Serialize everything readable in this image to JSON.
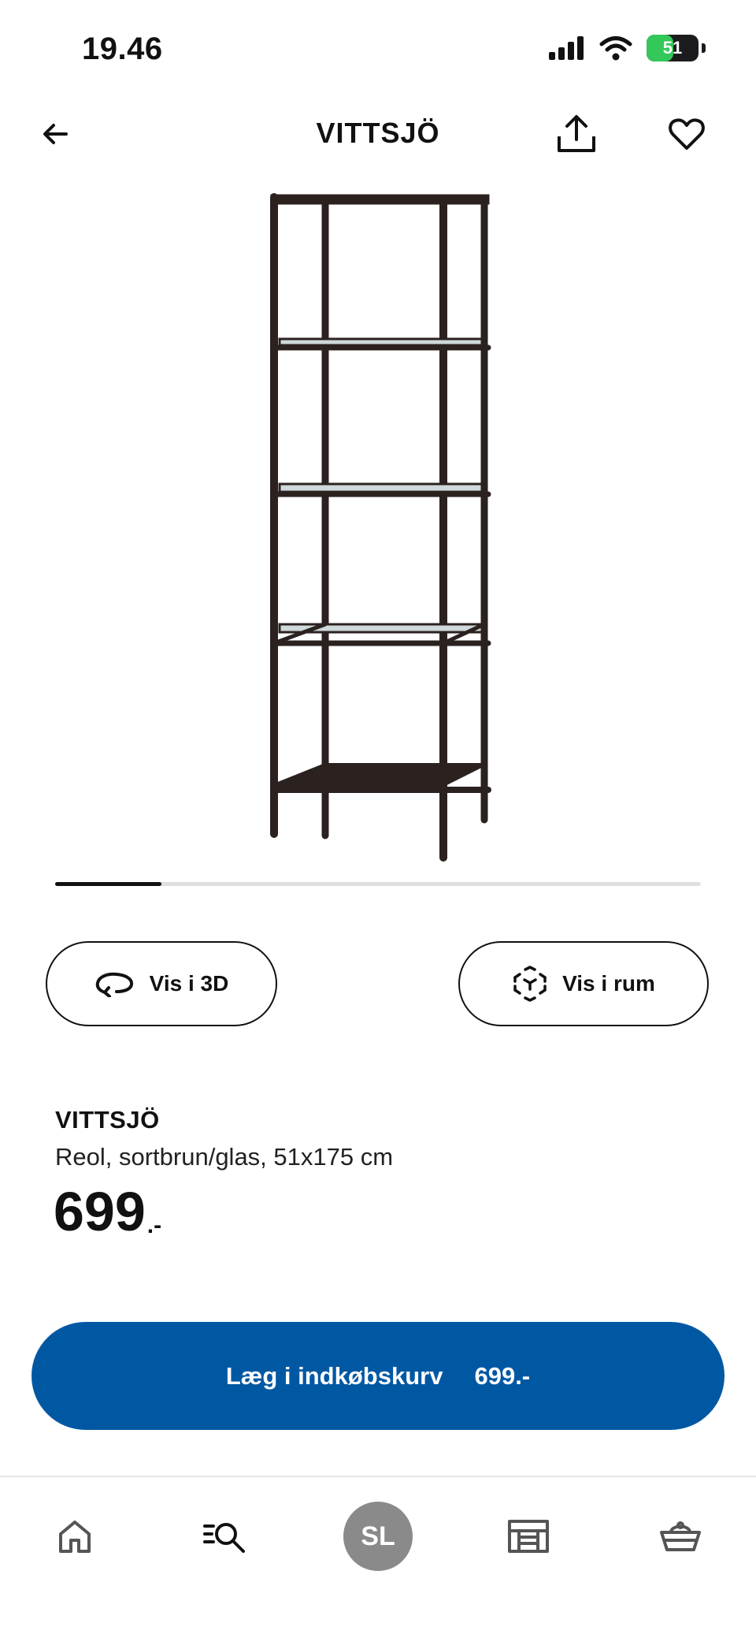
{
  "status_bar": {
    "time": "19.46",
    "battery_level": "51",
    "battery_fraction": 0.51,
    "icons": [
      "signal-icon",
      "wifi-icon",
      "battery-icon"
    ]
  },
  "nav": {
    "title": "VITTSJÖ",
    "icons": [
      "back-arrow-icon",
      "share-icon",
      "heart-icon"
    ]
  },
  "product": {
    "image": "shelf-unit-illustration",
    "name": "VITTSJÖ",
    "description": "Reol, sortbrun/glas, 51x175 cm",
    "price": "699",
    "price_suffix": ".-"
  },
  "carousel": {
    "current_fraction": 0.165
  },
  "actions": {
    "view_3d_label": "Vis i 3D",
    "view_room_label": "Vis i rum",
    "add_to_cart_label": "Læg i indkøbskurv",
    "add_to_cart_price": "699.-"
  },
  "tab_bar": {
    "avatar_initials": "SL",
    "icons": [
      "home-icon",
      "search-icon",
      "avatar",
      "store-icon",
      "basket-icon"
    ]
  },
  "colors": {
    "primary_blue": "#0058a3",
    "text": "#111111",
    "avatar_grey": "#8a8a8a",
    "divider": "#e6e6e6",
    "battery_green": "#34c759"
  }
}
